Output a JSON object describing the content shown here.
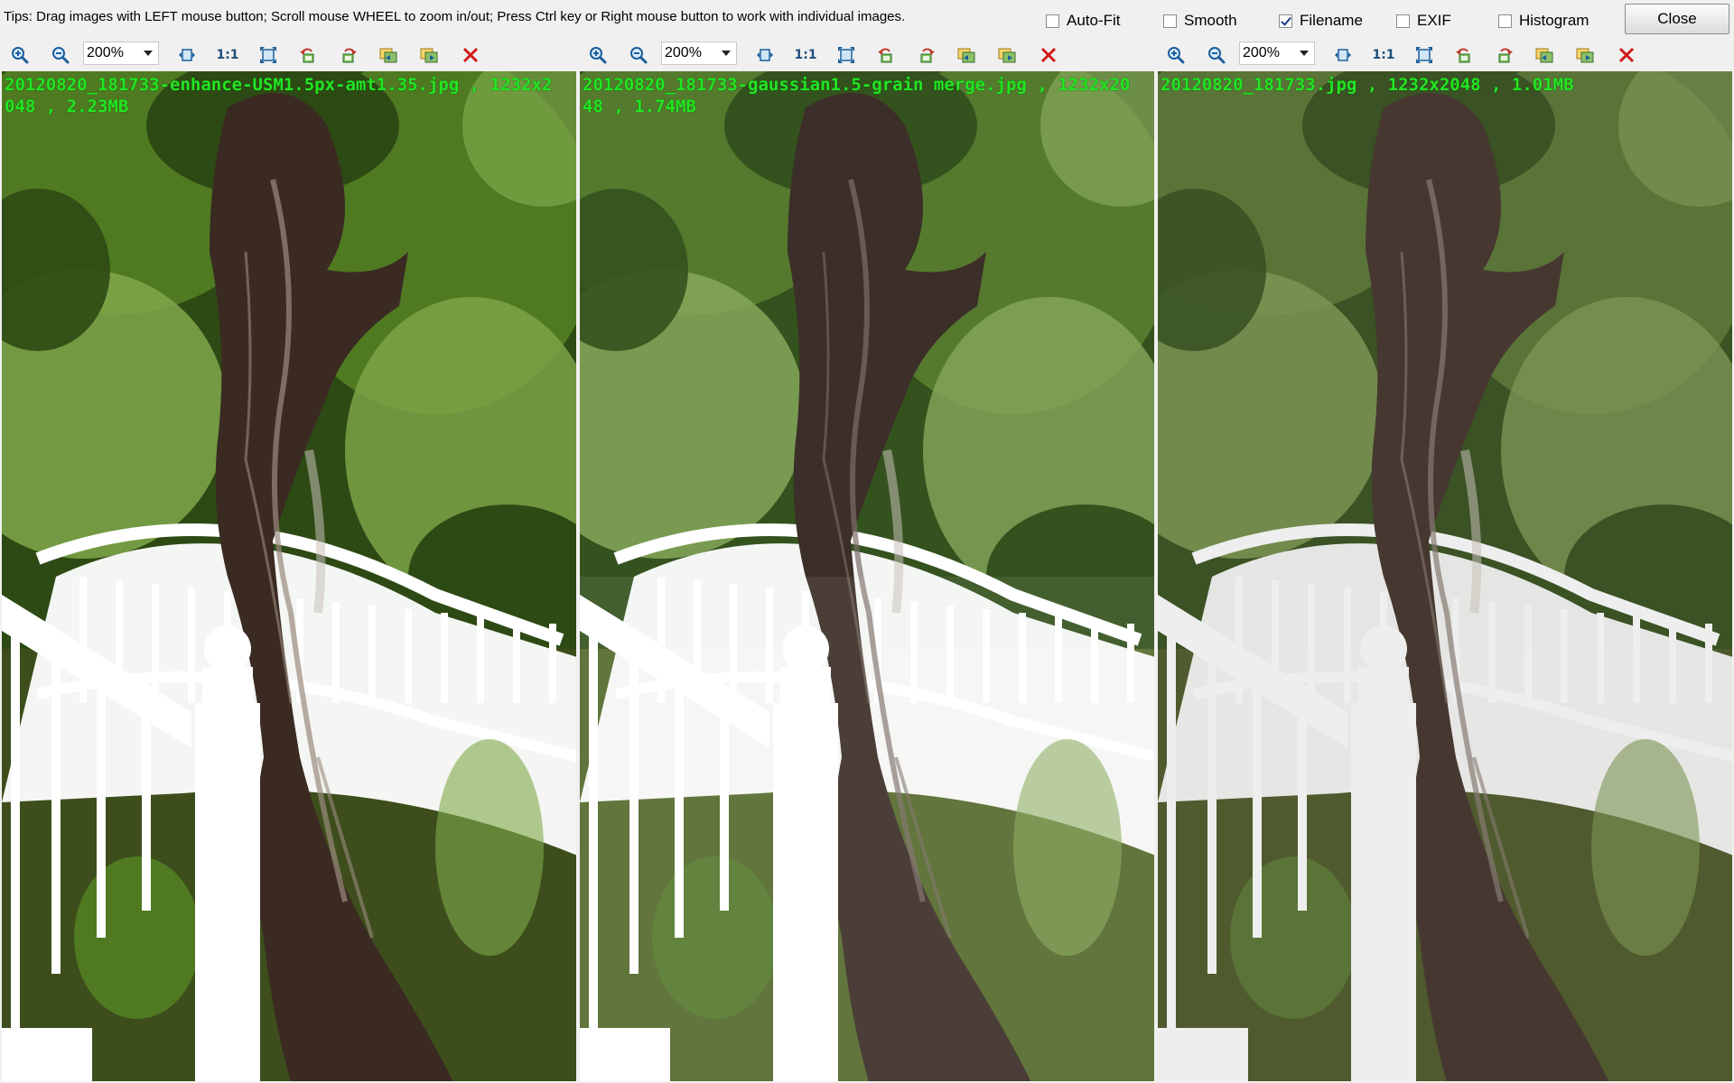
{
  "window": {
    "tips": "Tips: Drag images with LEFT mouse button; Scroll mouse WHEEL to zoom in/out; Press Ctrl key or Right mouse button to work with individual images.",
    "options": [
      {
        "label": "Auto-Fit",
        "checked": false
      },
      {
        "label": "Smooth",
        "checked": false
      },
      {
        "label": "Filename",
        "checked": true
      },
      {
        "label": "EXIF",
        "checked": false
      },
      {
        "label": "Histogram",
        "checked": false
      }
    ],
    "close_label": "Close"
  },
  "panels": [
    {
      "zoom": "200%",
      "one_to_one": "1:1",
      "caption": "20120820_181733-enhance-USM1.5px-amt1.35.jpg , 1232x2048 , 2.23MB",
      "style": "sharpened"
    },
    {
      "zoom": "200%",
      "one_to_one": "1:1",
      "caption": "20120820_181733-gaussian1.5-grain merge.jpg , 1232x2048 , 1.74MB",
      "style": "soft"
    },
    {
      "zoom": "200%",
      "one_to_one": "1:1",
      "caption": "20120820_181733.jpg , 1232x2048 , 1.01MB",
      "style": "original"
    }
  ],
  "colors": {
    "caption_text": "#22e622",
    "close_icon": "#d11a1a",
    "toolbar_icon": "#1b5e9b",
    "rotate_icon": "#2e8b2e"
  },
  "toolbar_icons": [
    "zoom-in-icon",
    "zoom-out-icon",
    "fit-width-icon",
    "actual-size-icon",
    "fit-window-icon",
    "rotate-left-icon",
    "rotate-right-icon",
    "previous-image-icon",
    "next-image-icon",
    "close-image-icon"
  ]
}
